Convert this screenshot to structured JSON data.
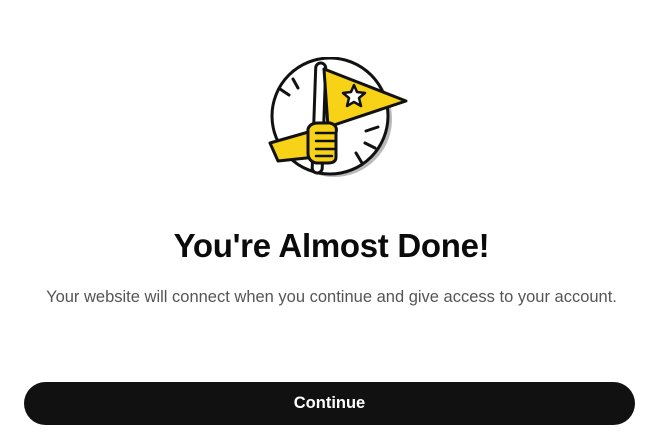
{
  "illustration": {
    "icon": "flag-in-hand-icon",
    "accent_color": "#f7d217",
    "outline_color": "#111111"
  },
  "heading": {
    "title": "You're Almost Done!",
    "subtitle": "Your website will connect when you continue and give access to your account."
  },
  "actions": {
    "continue_label": "Continue"
  }
}
